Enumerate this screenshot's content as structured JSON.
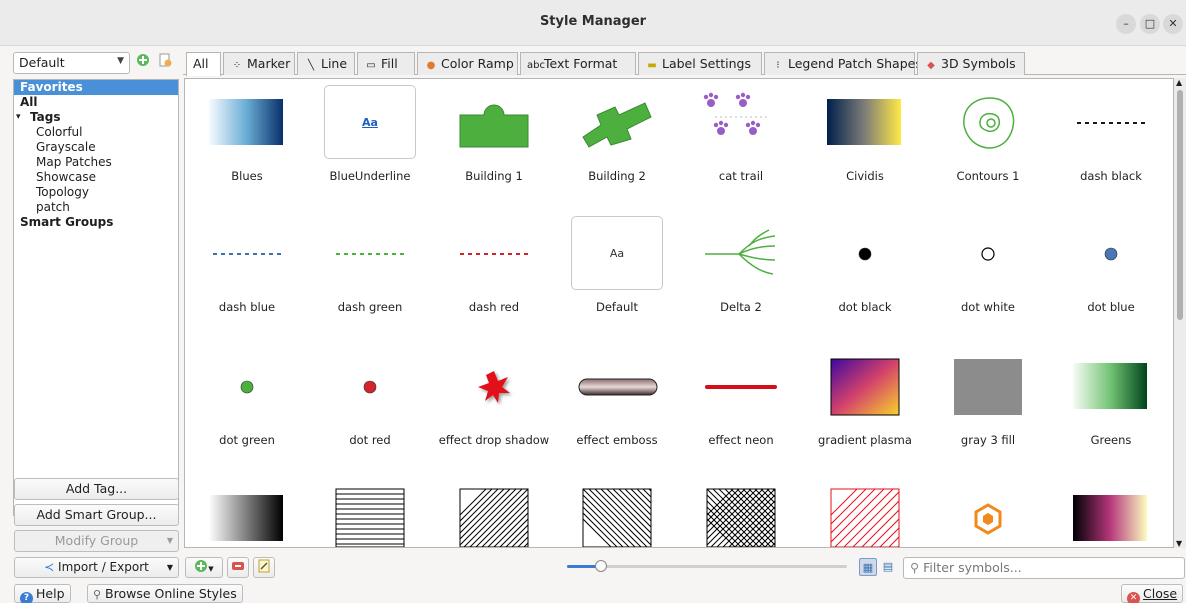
{
  "window": {
    "title": "Style Manager",
    "minimize": "–",
    "maximize": "□",
    "close": "✕"
  },
  "library": {
    "selected": "Default"
  },
  "tree": [
    {
      "label": "Favorites",
      "indent": 0,
      "bold": true,
      "selected": true
    },
    {
      "label": "All",
      "indent": 0,
      "bold": true
    },
    {
      "label": "Tags",
      "indent": 0,
      "bold": true,
      "expander": "▾"
    },
    {
      "label": "Colorful",
      "indent": 1
    },
    {
      "label": "Grayscale",
      "indent": 1
    },
    {
      "label": "Map Patches",
      "indent": 1
    },
    {
      "label": "Showcase",
      "indent": 1
    },
    {
      "label": "Topology",
      "indent": 1
    },
    {
      "label": "patch",
      "indent": 1
    },
    {
      "label": "Smart Groups",
      "indent": 0,
      "bold": true
    }
  ],
  "left_buttons": {
    "add_tag": "Add Tag...",
    "add_smart_group": "Add Smart Group...",
    "modify_group": "Modify Group"
  },
  "tabs": [
    {
      "label": "All",
      "icon": ""
    },
    {
      "label": "Marker",
      "icon": "⁘"
    },
    {
      "label": "Line",
      "icon": "╲"
    },
    {
      "label": "Fill",
      "icon": "▭"
    },
    {
      "label": "Color Ramp",
      "icon": "●"
    },
    {
      "label": "Text Format",
      "icon": "abc"
    },
    {
      "label": "Label Settings",
      "icon": "▬"
    },
    {
      "label": "Legend Patch Shapes",
      "icon": "⁝"
    },
    {
      "label": "3D Symbols",
      "icon": "◆"
    }
  ],
  "symbols": [
    {
      "name": "Blues",
      "kind": "ramp-blues"
    },
    {
      "name": "BlueUnderline",
      "kind": "text-blue",
      "text": "Aa"
    },
    {
      "name": "Building 1",
      "kind": "building1"
    },
    {
      "name": "Building 2",
      "kind": "building2"
    },
    {
      "name": "cat trail",
      "kind": "cattrail"
    },
    {
      "name": "Cividis",
      "kind": "ramp-cividis"
    },
    {
      "name": "Contours 1",
      "kind": "contours"
    },
    {
      "name": "dash  black",
      "kind": "dash",
      "color": "#1a1a1a"
    },
    {
      "name": "dash blue",
      "kind": "dash",
      "color": "#3d6fb4"
    },
    {
      "name": "dash green",
      "kind": "dash",
      "color": "#4caf3e"
    },
    {
      "name": "dash red",
      "kind": "dash",
      "color": "#d3252c"
    },
    {
      "name": "Default",
      "kind": "text-default",
      "text": "Aa"
    },
    {
      "name": "Delta 2",
      "kind": "delta"
    },
    {
      "name": "dot  black",
      "kind": "dot",
      "color": "#000000"
    },
    {
      "name": "dot  white",
      "kind": "dot-white"
    },
    {
      "name": "dot blue",
      "kind": "dot",
      "color": "#4a76b8"
    },
    {
      "name": "dot green",
      "kind": "dot",
      "color": "#4caf3e"
    },
    {
      "name": "dot red",
      "kind": "dot",
      "color": "#d3252c"
    },
    {
      "name": "effect drop shadow",
      "kind": "starburst"
    },
    {
      "name": "effect emboss",
      "kind": "emboss"
    },
    {
      "name": "effect neon",
      "kind": "neon"
    },
    {
      "name": "gradient  plasma",
      "kind": "ramp-plasma"
    },
    {
      "name": "gray 3 fill",
      "kind": "gray-fill"
    },
    {
      "name": "Greens",
      "kind": "ramp-greens"
    },
    {
      "name": "",
      "kind": "ramp-grays"
    },
    {
      "name": "",
      "kind": "hatch-horizontal"
    },
    {
      "name": "",
      "kind": "hatch-diagonal"
    },
    {
      "name": "",
      "kind": "hatch-back"
    },
    {
      "name": "",
      "kind": "hatch-cross"
    },
    {
      "name": "",
      "kind": "hatch-red"
    },
    {
      "name": "",
      "kind": "hexagon"
    },
    {
      "name": "",
      "kind": "ramp-magma"
    }
  ],
  "bottom": {
    "import_export": "Import / Export",
    "filter_placeholder": "Filter symbols...",
    "zoom_fraction": 0.12
  },
  "footer": {
    "help": "Help",
    "browse": "Browse Online Styles",
    "close": "Close"
  }
}
